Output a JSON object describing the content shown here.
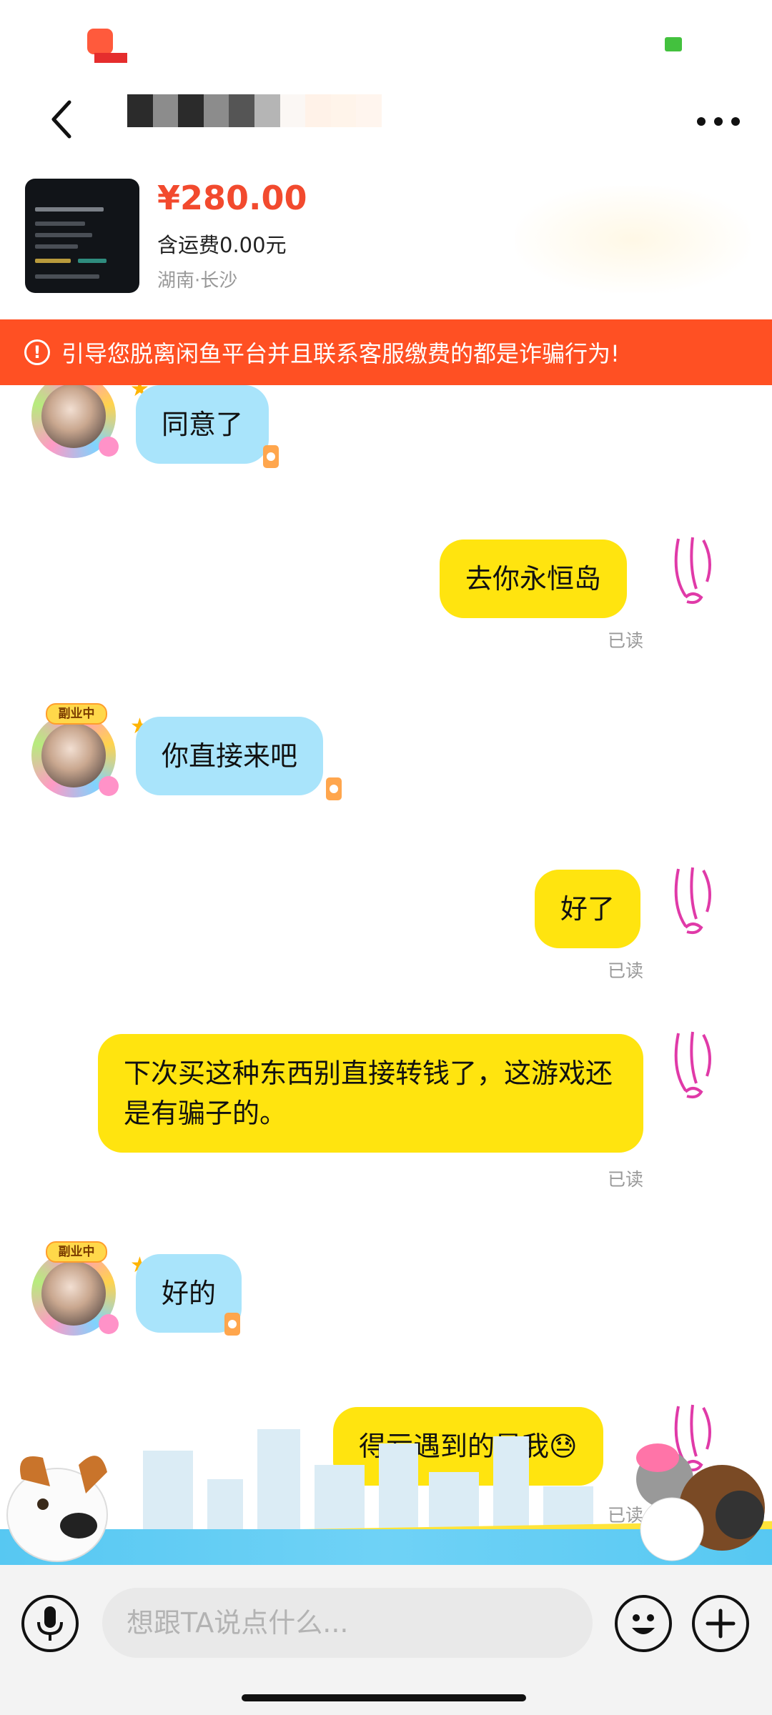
{
  "product": {
    "price": "¥280.00",
    "shipping": "含运费0.00元",
    "location": "湖南·长沙"
  },
  "warning": {
    "text": "引导您脱离闲鱼平台并且联系客服缴费的都是诈骗行为!"
  },
  "avatar_badge": "副业中",
  "messages": [
    {
      "side": "in",
      "text": "同意了"
    },
    {
      "side": "out",
      "text": "去你永恒岛",
      "status": "已读"
    },
    {
      "side": "in",
      "text": "你直接来吧"
    },
    {
      "side": "out",
      "text": "好了",
      "status": "已读"
    },
    {
      "side": "out",
      "text": "下次买这种东西别直接转钱了，这游戏还是有骗子的。",
      "status": "已读"
    },
    {
      "side": "in",
      "text": "好的"
    },
    {
      "side": "out",
      "text": "得亏遇到的是我😓",
      "status": "已读"
    }
  ],
  "input": {
    "placeholder": "想跟TA说点什么..."
  },
  "colors": {
    "accent": "#f24a2e",
    "warning_bg": "#ff5023",
    "bubble_in": "#a9e4fb",
    "bubble_out": "#ffe40f"
  },
  "icons": {
    "back": "chevron-left-icon",
    "more": "more-dots-icon",
    "warning": "alert-circle-icon",
    "voice": "microphone-icon",
    "emoji": "smile-icon",
    "plus": "plus-icon"
  }
}
